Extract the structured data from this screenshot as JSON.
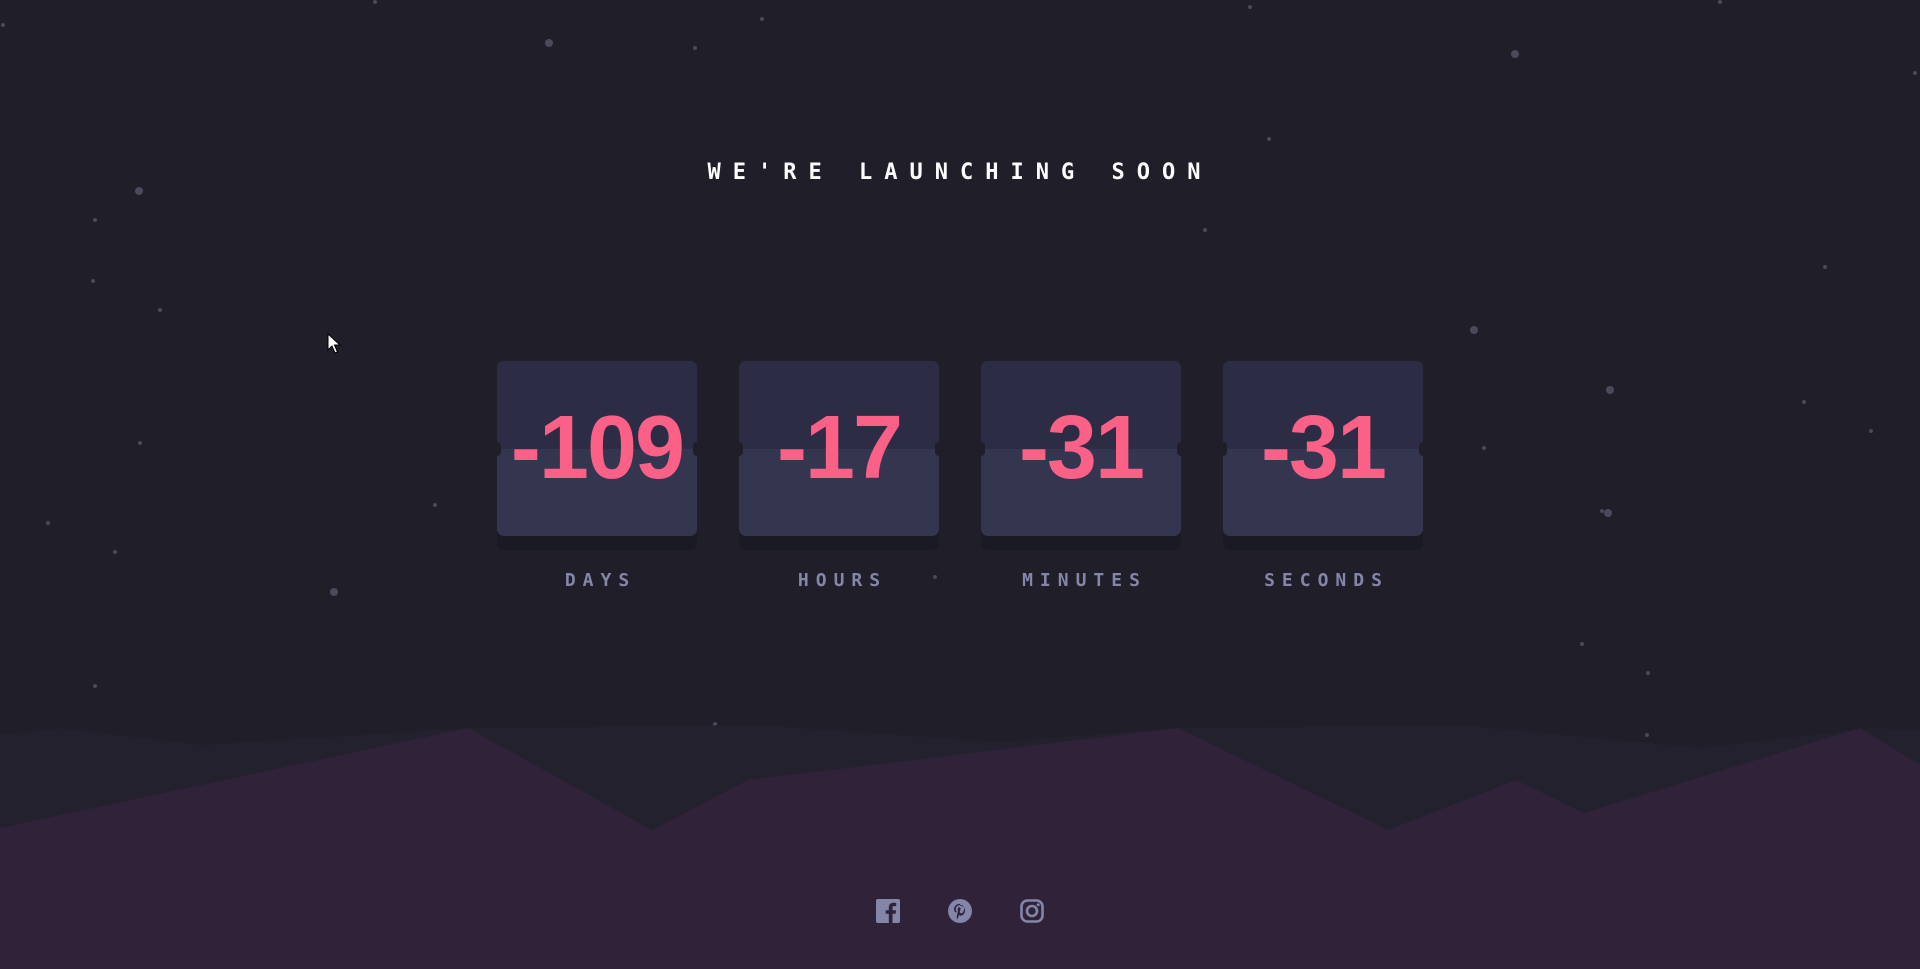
{
  "headline": "WE'RE LAUNCHING SOON",
  "countdown": [
    {
      "value": "-109",
      "label": "DAYS"
    },
    {
      "value": "-17",
      "label": "HOURS"
    },
    {
      "value": "-31",
      "label": "MINUTES"
    },
    {
      "value": "-31",
      "label": "SECONDS"
    }
  ],
  "social": [
    {
      "icon": "facebook-icon"
    },
    {
      "icon": "pinterest-icon"
    },
    {
      "icon": "instagram-icon"
    }
  ],
  "colors": {
    "background": "#1f1e29",
    "card": "#343650",
    "card_top": "#2c2c44",
    "digits": "#fb6087",
    "label": "#8486a9",
    "hills_front": "#2f2239",
    "icon": "#8486a9"
  }
}
